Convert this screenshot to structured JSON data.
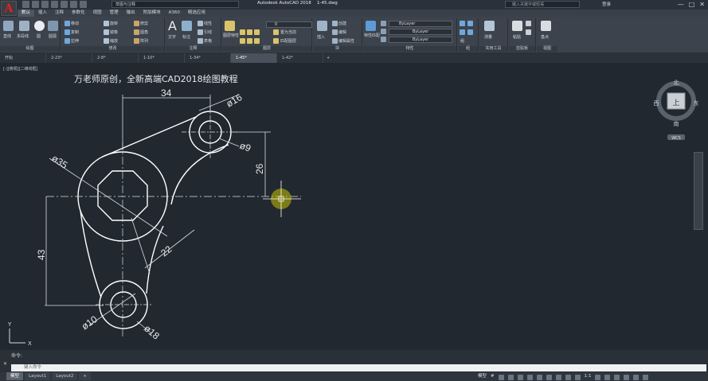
{
  "titlebar": {
    "logo": "A",
    "workspace": "草图与注释",
    "app_title": "Autodesk AutoCAD 2018",
    "file_name": "1-45.dwg",
    "search_placeholder": "键入关键字或短语",
    "user": "登录",
    "minimize": "—",
    "maximize": "□",
    "close": "✕"
  },
  "menu": [
    "默认",
    "插入",
    "注释",
    "参数化",
    "视图",
    "管理",
    "输出",
    "附加模块",
    "A360",
    "精选应用"
  ],
  "ribbon": {
    "draw": {
      "title": "绘图",
      "line": "直线",
      "polyline": "多段线",
      "circle": "圆",
      "arc": "圆弧"
    },
    "modify": {
      "title": "修改",
      "move": "移动",
      "rotate": "旋转",
      "trim": "修剪",
      "copy": "复制",
      "mirror": "镜像",
      "fillet": "圆角",
      "stretch": "拉伸",
      "scale": "缩放",
      "array": "阵列"
    },
    "annotation": {
      "title": "注释",
      "text": "文字",
      "dimension": "标注",
      "linear": "线性",
      "leader": "引线",
      "table": "表格"
    },
    "layers": {
      "title": "图层",
      "layer_props": "图层特性",
      "current_layer": "0",
      "make_current": "置为当前",
      "match_layer": "匹配图层"
    },
    "block": {
      "title": "块",
      "insert": "插入",
      "create": "创建",
      "edit": "编辑",
      "edit_attr": "编辑属性"
    },
    "properties": {
      "title": "特性",
      "match": "特性匹配",
      "color": "ByLayer",
      "linetype": "ByLayer",
      "lineweight": "ByLayer"
    },
    "groups": {
      "title": "组",
      "group": "组"
    },
    "utilities": {
      "title": "实用工具",
      "measure": "测量"
    },
    "clipboard": {
      "title": "剪贴板",
      "paste": "粘贴"
    },
    "view": {
      "title": "视图",
      "base": "基点"
    }
  },
  "file_tabs": [
    "开始",
    "2-23*",
    "2-8*",
    "1-10*",
    "1-34*",
    "1-45*",
    "1-42*"
  ],
  "file_tab_add": "+",
  "active_file_tab": 5,
  "viewport_label": "[-][俯视][二维线框]",
  "drawing_title": "万老师原创，全新高端CAD2018绘图教程",
  "dimensions": {
    "d34": "34",
    "d16": "ø16",
    "d9": "ø9",
    "d26": "26",
    "d35": "ø35",
    "d22": "22",
    "d43": "43",
    "d10": "ø10",
    "d18": "ø18"
  },
  "viewcube": {
    "north": "北",
    "south": "南",
    "east": "东",
    "west": "西",
    "top": "上",
    "wcs": "WCS"
  },
  "ucs": {
    "x": "X",
    "y": "Y"
  },
  "command": {
    "history": "命令:",
    "placeholder": "键入命令",
    "close": "✕"
  },
  "layout_tabs": [
    "模型",
    "Layout1",
    "Layout2",
    "+"
  ],
  "status": {
    "model": "模型",
    "grid": "#",
    "scale": "1:1"
  },
  "colors": {
    "canvas": "#212830",
    "cursor": "#c8c000",
    "drawing": "#ffffff"
  }
}
